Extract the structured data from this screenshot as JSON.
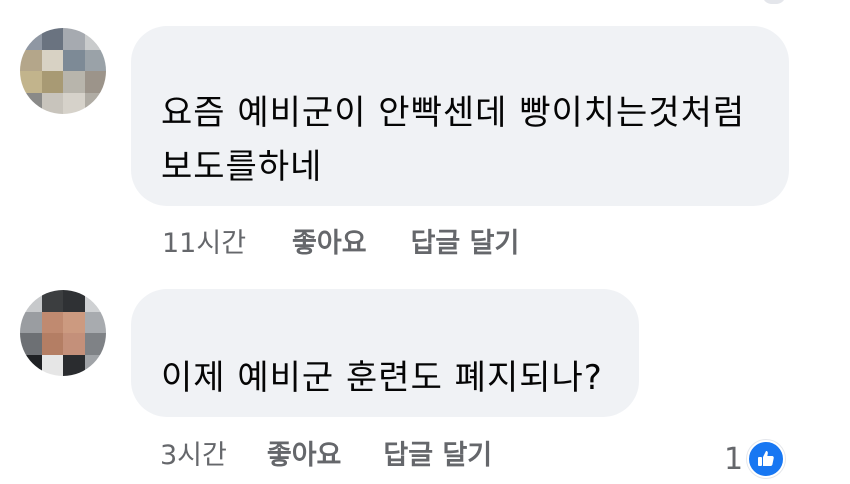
{
  "comments": [
    {
      "author": "",
      "text": "요즘 예비군이 안빡센데 빵이치는것처럼\n보도를하네",
      "timestamp": "11시간",
      "like_label": "좋아요",
      "reply_label": "답글 달기"
    },
    {
      "author": "",
      "text": "이제 예비군 훈련도 폐지되나?",
      "timestamp": "3시간",
      "like_label": "좋아요",
      "reply_label": "답글 달기",
      "reaction_count": "1",
      "reaction_icon": "thumbs-up-icon"
    }
  ],
  "colors": {
    "bubble": "#f0f2f5",
    "meta_text": "#65676b",
    "like_blue": "#1877f2"
  }
}
